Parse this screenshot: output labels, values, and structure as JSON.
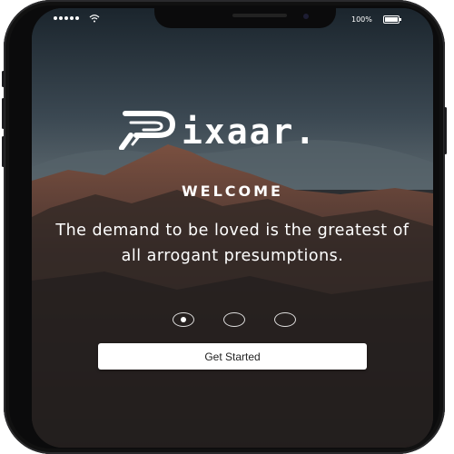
{
  "status_bar": {
    "battery_percent": "100%"
  },
  "brand": {
    "name": "ixaar."
  },
  "onboarding": {
    "heading": "WELCOME",
    "quote": "The demand to be loved is the greatest of all arrogant presumptions.",
    "slides_total": 3,
    "active_slide": 1,
    "cta_label": "Get Started"
  },
  "colors": {
    "accent": "#ffffff",
    "sky": "#2c3943",
    "mountain": "#5a3a2e"
  },
  "icons": [
    "signal-icon",
    "wifi-icon",
    "battery-icon",
    "pixaar-logo-icon"
  ]
}
